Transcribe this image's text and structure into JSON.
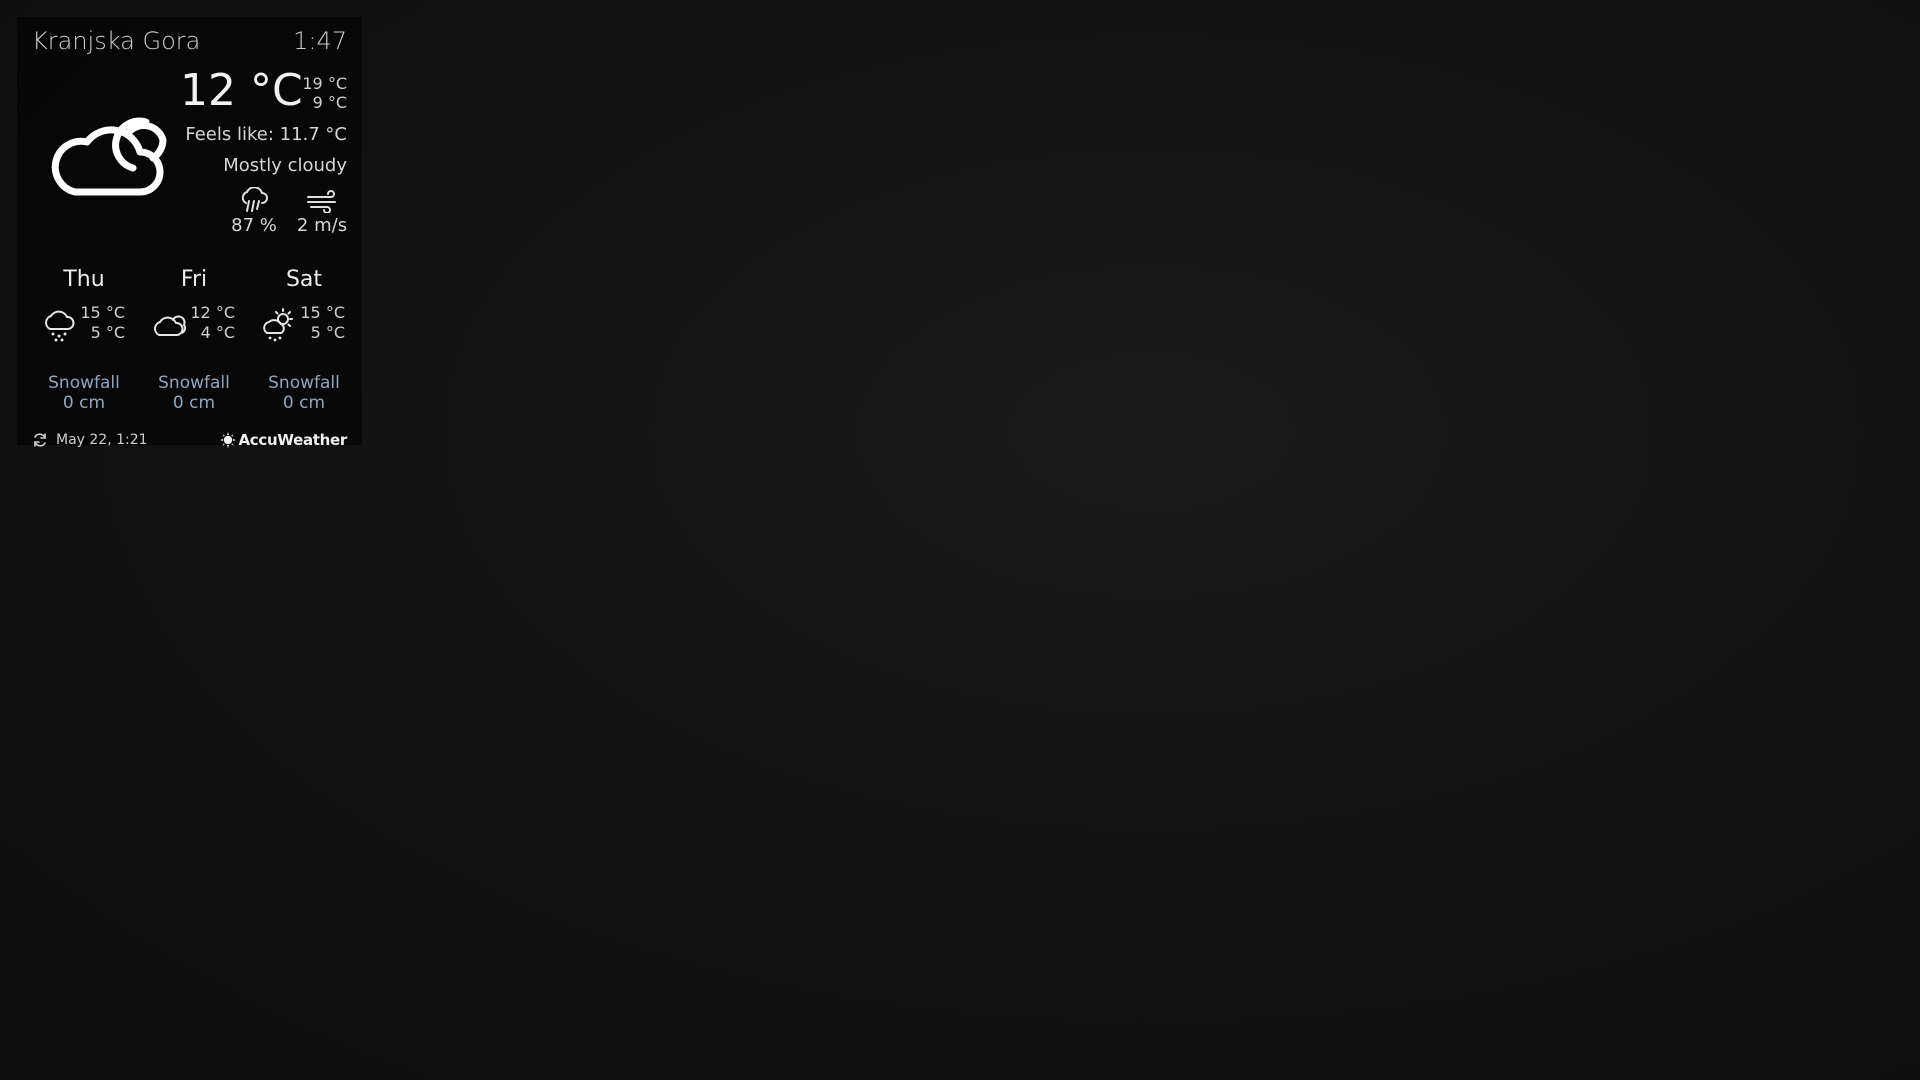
{
  "widget": {
    "location": "Kranjska Gora",
    "time": "1:47",
    "current": {
      "icon": "cloud-moon-icon",
      "temperature": "12 °C",
      "high": "19 °C",
      "low": "9 °C",
      "feels_like": "Feels like: 11.7 °C",
      "condition": "Mostly cloudy",
      "precipitation": {
        "icon": "rain-cloud-icon",
        "value": "87 %"
      },
      "wind": {
        "icon": "wind-icon",
        "value": "2 m/s"
      }
    },
    "forecast": [
      {
        "day": "Thu",
        "icon": "snow-cloud-icon",
        "high": "15 °C",
        "low": "5 °C",
        "snow_label": "Snowfall",
        "snow_value": "0 cm"
      },
      {
        "day": "Fri",
        "icon": "cloud-icon",
        "high": "12 °C",
        "low": "4 °C",
        "snow_label": "Snowfall",
        "snow_value": "0 cm"
      },
      {
        "day": "Sat",
        "icon": "sun-cloud-rain-icon",
        "high": "15 °C",
        "low": "5 °C",
        "snow_label": "Snowfall",
        "snow_value": "0 cm"
      }
    ],
    "footer": {
      "refresh_icon": "refresh-icon",
      "updated": "May 22, 1:21",
      "brand": "AccuWeather"
    }
  },
  "colors": {
    "background": "#121212",
    "text": "#e8e8e8",
    "snow_text": "#8fa6bf"
  }
}
